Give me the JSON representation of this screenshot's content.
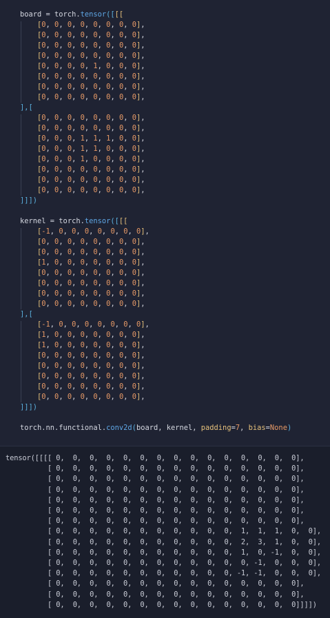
{
  "code": {
    "board_open": "board = torch.tensor([[[",
    "board_rows_1": [
      "[0, 0, 0, 0, 0, 0, 0, 0],",
      "[0, 0, 0, 0, 0, 0, 0, 0],",
      "[0, 0, 0, 0, 0, 0, 0, 0],",
      "[0, 0, 0, 0, 0, 0, 0, 0],",
      "[0, 0, 0, 0, 1, 0, 0, 0],",
      "[0, 0, 0, 0, 0, 0, 0, 0],",
      "[0, 0, 0, 0, 0, 0, 0, 0],",
      "[0, 0, 0, 0, 0, 0, 0, 0],"
    ],
    "board_sep": "],[",
    "board_rows_2": [
      "[0, 0, 0, 0, 0, 0, 0, 0],",
      "[0, 0, 0, 0, 0, 0, 0, 0],",
      "[0, 0, 0, 1, 1, 1, 0, 0],",
      "[0, 0, 0, 1, 1, 0, 0, 0],",
      "[0, 0, 0, 1, 0, 0, 0, 0],",
      "[0, 0, 0, 0, 0, 0, 0, 0],",
      "[0, 0, 0, 0, 0, 0, 0, 0],",
      "[0, 0, 0, 0, 0, 0, 0, 0],"
    ],
    "board_close": "]]])",
    "kernel_open": "kernel = torch.tensor([[[",
    "kernel_rows_1": [
      "[-1, 0, 0, 0, 0, 0, 0, 0],",
      "[0, 0, 0, 0, 0, 0, 0, 0],",
      "[0, 0, 0, 0, 0, 0, 0, 0],",
      "[1, 0, 0, 0, 0, 0, 0, 0],",
      "[0, 0, 0, 0, 0, 0, 0, 0],",
      "[0, 0, 0, 0, 0, 0, 0, 0],",
      "[0, 0, 0, 0, 0, 0, 0, 0],",
      "[0, 0, 0, 0, 0, 0, 0, 0],"
    ],
    "kernel_sep": "],[",
    "kernel_rows_2": [
      "[-1, 0, 0, 0, 0, 0, 0, 0],",
      "[1, 0, 0, 0, 0, 0, 0, 0],",
      "[1, 0, 0, 0, 0, 0, 0, 0],",
      "[0, 0, 0, 0, 0, 0, 0, 0],",
      "[0, 0, 0, 0, 0, 0, 0, 0],",
      "[0, 0, 0, 0, 0, 0, 0, 0],",
      "[0, 0, 0, 0, 0, 0, 0, 0],",
      "[0, 0, 0, 0, 0, 0, 0, 0],"
    ],
    "kernel_close": "]]])",
    "conv_line": "torch.nn.functional.conv2d(board, kernel, padding=7, bias=None)"
  },
  "output": {
    "lines": [
      "tensor([[[[ 0,  0,  0,  0,  0,  0,  0,  0,  0,  0,  0,  0,  0,  0,  0],",
      "          [ 0,  0,  0,  0,  0,  0,  0,  0,  0,  0,  0,  0,  0,  0,  0],",
      "          [ 0,  0,  0,  0,  0,  0,  0,  0,  0,  0,  0,  0,  0,  0,  0],",
      "          [ 0,  0,  0,  0,  0,  0,  0,  0,  0,  0,  0,  0,  0,  0,  0],",
      "          [ 0,  0,  0,  0,  0,  0,  0,  0,  0,  0,  0,  0,  0,  0,  0],",
      "          [ 0,  0,  0,  0,  0,  0,  0,  0,  0,  0,  0,  0,  0,  0,  0],",
      "          [ 0,  0,  0,  0,  0,  0,  0,  0,  0,  0,  0,  0,  0,  0,  0],",
      "          [ 0,  0,  0,  0,  0,  0,  0,  0,  0,  0,  0,  1,  1,  1,  0,  0],",
      "          [ 0,  0,  0,  0,  0,  0,  0,  0,  0,  0,  0,  2,  3,  1,  0,  0],",
      "          [ 0,  0,  0,  0,  0,  0,  0,  0,  0,  0,  0,  1,  0, -1,  0,  0],",
      "          [ 0,  0,  0,  0,  0,  0,  0,  0,  0,  0,  0,  0, -1,  0,  0,  0],",
      "          [ 0,  0,  0,  0,  0,  0,  0,  0,  0,  0,  0, -1, -1,  0,  0,  0],",
      "          [ 0,  0,  0,  0,  0,  0,  0,  0,  0,  0,  0,  0,  0,  0,  0],",
      "          [ 0,  0,  0,  0,  0,  0,  0,  0,  0,  0,  0,  0,  0,  0,  0],",
      "          [ 0,  0,  0,  0,  0,  0,  0,  0,  0,  0,  0,  0,  0,  0,  0]]]])"
    ]
  }
}
